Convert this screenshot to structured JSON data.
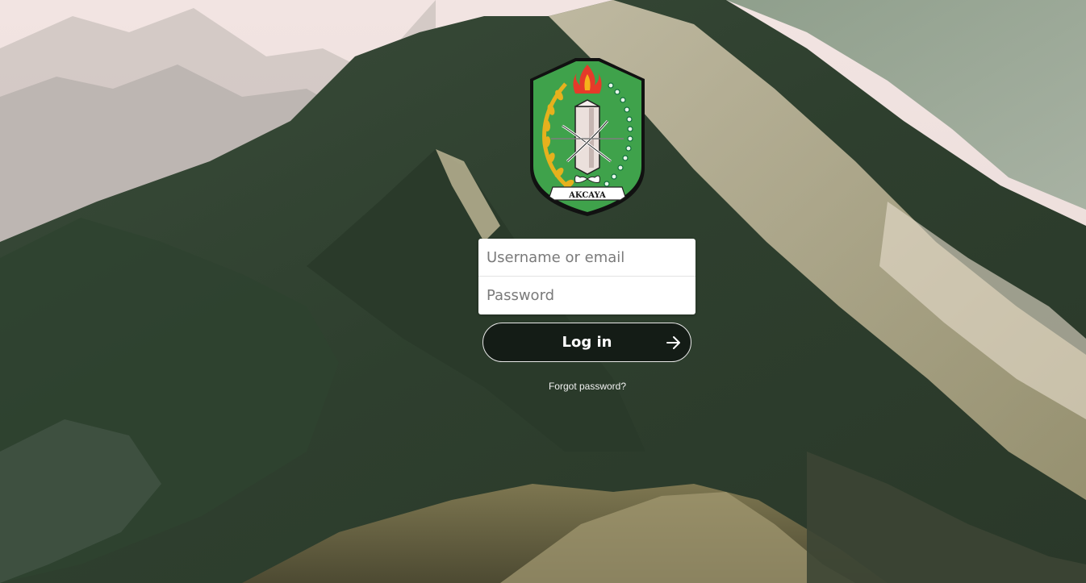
{
  "background": {
    "description_icon": "mountain-landscape-image",
    "colors": {
      "sky": "#efe2e0",
      "far_mountains": "#bdb7b3",
      "dark_green": "#2b3a2a",
      "mid_green": "#3f5540",
      "light_slope": "#c9c0a5"
    }
  },
  "logo": {
    "icon": "kalimantan-barat-coat-of-arms",
    "ribbon_text": "AKCAYA",
    "colors": {
      "shield": "#3fa24b",
      "flame": "#e53a2a",
      "wreath_left": "#e6b11d",
      "wreath_right": "#1d9a56"
    }
  },
  "form": {
    "username_placeholder": "Username or email",
    "password_placeholder": "Password",
    "login_label": "Log in",
    "login_icon": "arrow-right-icon",
    "forgot_link": "Forgot password?"
  }
}
